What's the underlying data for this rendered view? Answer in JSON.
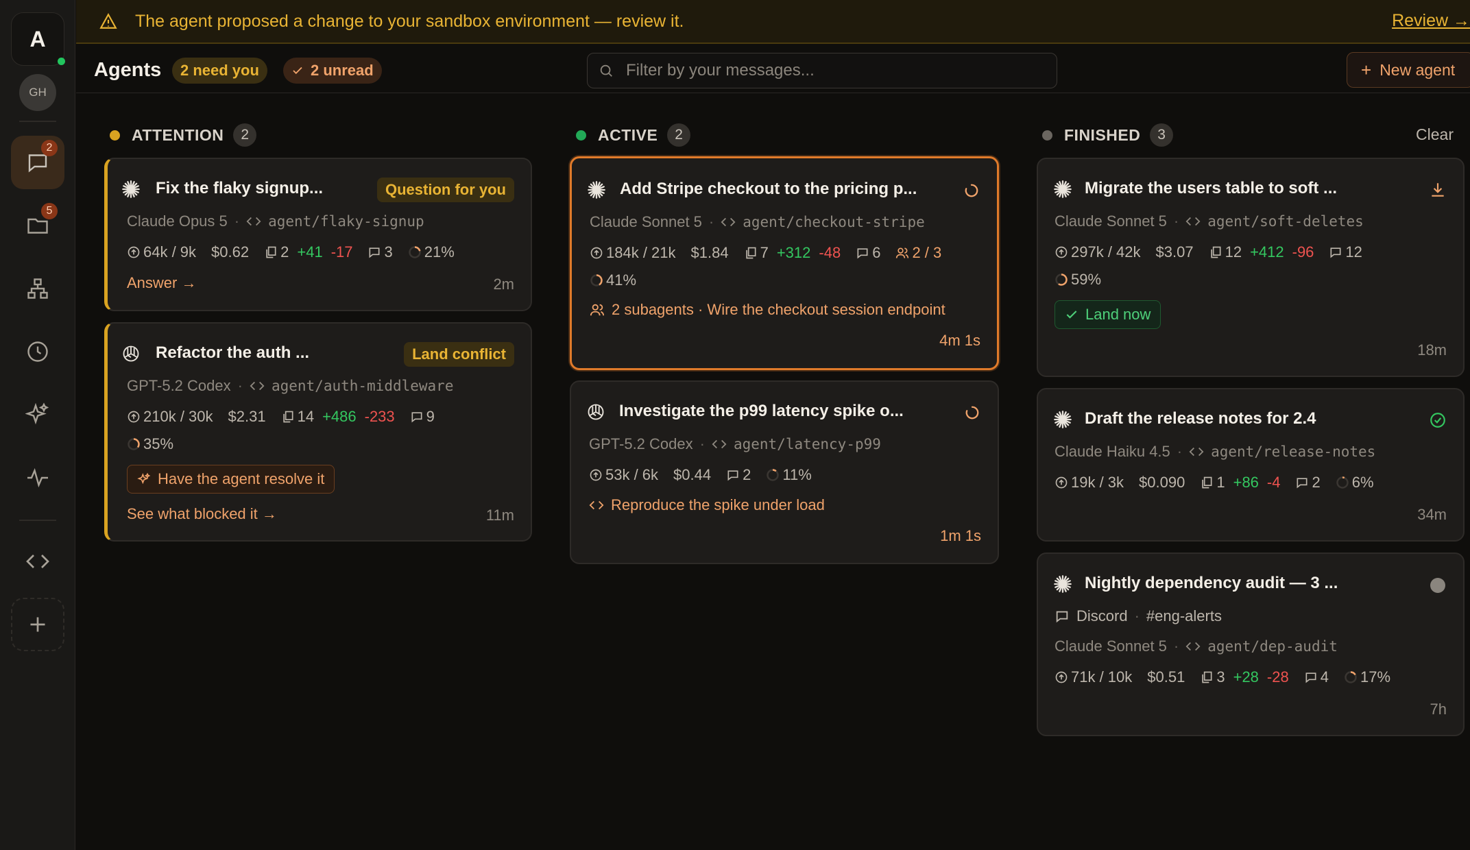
{
  "app": {
    "logo_letter": "A",
    "user_initials": "GH"
  },
  "rail": {
    "chat_badge": "2",
    "folder_badge": "5"
  },
  "banner": {
    "text": "The agent proposed a change to your sandbox environment — review it.",
    "link": "Review →"
  },
  "header": {
    "title": "Agents",
    "need_you": "2 need you",
    "unread": "2 unread",
    "search_placeholder": "Filter by your messages...",
    "new_agent": "New agent"
  },
  "colors": {
    "attention": "#d9a321",
    "active": "#22a957",
    "finished": "#6b6660",
    "accent": "#f0a36b",
    "plus": "#34c760",
    "minus": "#ef5350"
  },
  "columns": [
    {
      "label": "ATTENTION",
      "count": "2"
    },
    {
      "label": "ACTIVE",
      "count": "2"
    },
    {
      "label": "FINISHED",
      "count": "3",
      "clear": "Clear"
    }
  ],
  "cards": {
    "flaky": {
      "icon": "claude-star-icon",
      "title": "Fix the flaky signup...",
      "tag": "Question for you",
      "model": "Claude Opus 5",
      "branch": "agent/flaky-signup",
      "tokens": "64k / 9k",
      "cost": "$0.62",
      "files": "2",
      "plus": "+41",
      "minus": "-17",
      "comments": "3",
      "progress": "21%",
      "progress_value": 0.21,
      "link": "Answer →",
      "time": "2m"
    },
    "auth": {
      "icon": "openai-icon",
      "title": "Refactor the auth ...",
      "tag": "Land conflict",
      "model": "GPT-5.2 Codex",
      "branch": "agent/auth-middleware",
      "tokens": "210k / 30k",
      "cost": "$2.31",
      "files": "14",
      "plus": "+486",
      "minus": "-233",
      "comments": "9",
      "progress": "35%",
      "progress_value": 0.35,
      "action": "Have the agent resolve it",
      "link": "See what blocked it →",
      "time": "11m"
    },
    "stripe": {
      "icon": "claude-star-icon",
      "title": "Add Stripe checkout to the pricing p...",
      "model": "Claude Sonnet 5",
      "branch": "agent/checkout-stripe",
      "tokens": "184k / 21k",
      "cost": "$1.84",
      "files": "7",
      "plus": "+312",
      "minus": "-48",
      "comments": "6",
      "subagents_count": "2 / 3",
      "progress": "41%",
      "progress_value": 0.41,
      "subagents": "2 subagents · Wire the checkout session endpoint",
      "time": "4m 1s"
    },
    "latency": {
      "icon": "openai-icon",
      "title": "Investigate the p99 latency spike o...",
      "model": "GPT-5.2 Codex",
      "branch": "agent/latency-p99",
      "tokens": "53k / 6k",
      "cost": "$0.44",
      "comments": "2",
      "progress": "11%",
      "progress_value": 0.11,
      "step": "Reproduce the spike under load",
      "time": "1m 1s"
    },
    "softdel": {
      "icon": "claude-star-icon",
      "title": "Migrate the users table to soft ...",
      "model": "Claude Sonnet 5",
      "branch": "agent/soft-deletes",
      "tokens": "297k / 42k",
      "cost": "$3.07",
      "files": "12",
      "plus": "+412",
      "minus": "-96",
      "comments": "12",
      "progress": "59%",
      "progress_value": 0.59,
      "action": "Land now",
      "time": "18m"
    },
    "notes": {
      "icon": "claude-star-icon",
      "title": "Draft the release notes for 2.4",
      "model": "Claude Haiku 4.5",
      "branch": "agent/release-notes",
      "tokens": "19k / 3k",
      "cost": "$0.090",
      "files": "1",
      "plus": "+86",
      "minus": "-4",
      "comments": "2",
      "progress": "6%",
      "progress_value": 0.06,
      "time": "34m"
    },
    "audit": {
      "icon": "claude-star-icon",
      "title": "Nightly dependency audit — 3 ...",
      "source": "Discord",
      "channel": "#eng-alerts",
      "model": "Claude Sonnet 5",
      "branch": "agent/dep-audit",
      "tokens": "71k / 10k",
      "cost": "$0.51",
      "files": "3",
      "plus": "+28",
      "minus": "-28",
      "comments": "4",
      "progress": "17%",
      "progress_value": 0.17,
      "time": "7h"
    }
  }
}
